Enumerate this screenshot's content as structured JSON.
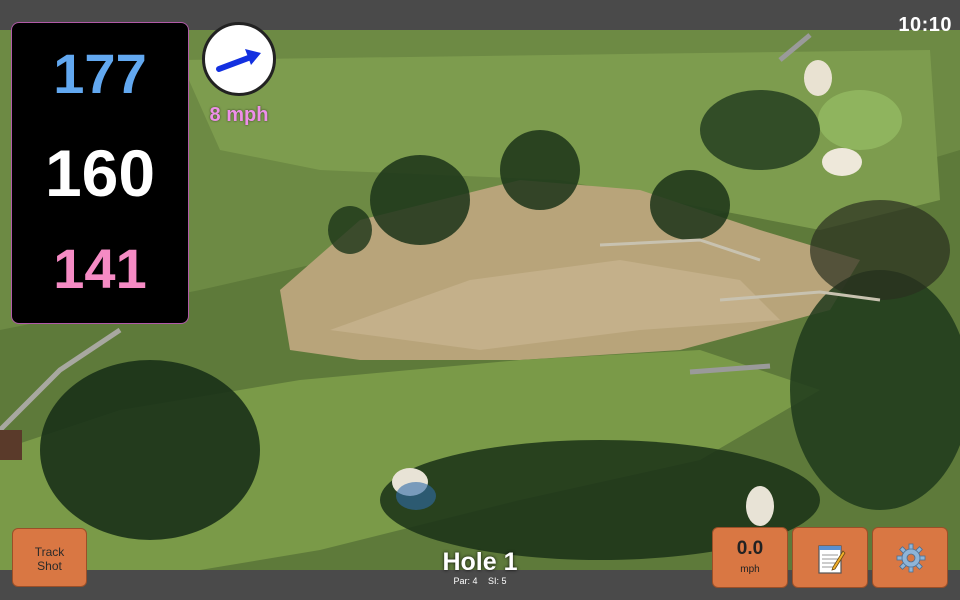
{
  "status_bar": {
    "time": "10:10"
  },
  "yardages": {
    "back": "177",
    "middle": "160",
    "front": "141"
  },
  "wind": {
    "speed_label": "8 mph",
    "icon": "wind-direction-arrow-icon"
  },
  "buttons": {
    "track_shot_line1": "Track",
    "track_shot_line2": "Shot",
    "speed_value": "0.0",
    "speed_unit": "mph",
    "notes_icon": "notepad-icon",
    "settings_icon": "gear-icon"
  },
  "hole": {
    "title": "Hole 1",
    "par": "Par: 4",
    "si": "SI: 5"
  },
  "colors": {
    "back_yardage": "#62a8f0",
    "middle_yardage": "#ffffff",
    "front_yardage": "#f58bc4",
    "wind_label": "#ee8fe9",
    "button": "#d97743"
  }
}
